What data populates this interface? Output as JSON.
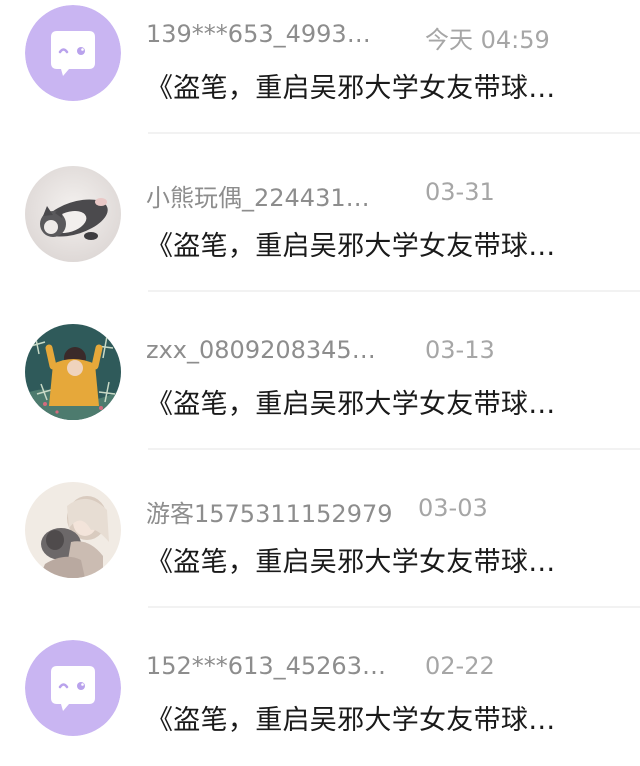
{
  "messages": [
    {
      "username": "139***653_4993…",
      "time": "今天 04:59",
      "text": "《盗笔，重启吴邪大学女友带球…",
      "avatar": "default-purple-chat-icon",
      "avatar_color": "#c9b5f2"
    },
    {
      "username": "小熊玩偶_224431…",
      "time": "03-31",
      "text": "《盗笔，重启吴邪大学女友带球…",
      "avatar": "kitten-photo"
    },
    {
      "username": "zxx_0809208345…",
      "time": "03-13",
      "text": "《盗笔，重启吴邪大学女友带球…",
      "avatar": "illustrated-girl-yellow-sweater"
    },
    {
      "username": "游客1575311152979",
      "time": "03-03",
      "text": "《盗笔，重启吴邪大学女友带球…",
      "avatar": "illustrated-girl-with-dog"
    },
    {
      "username": "152***613_45263…",
      "time": "02-22",
      "text": "《盗笔，重启吴邪大学女友带球…",
      "avatar": "default-purple-chat-icon",
      "avatar_color": "#c9b5f2"
    }
  ]
}
